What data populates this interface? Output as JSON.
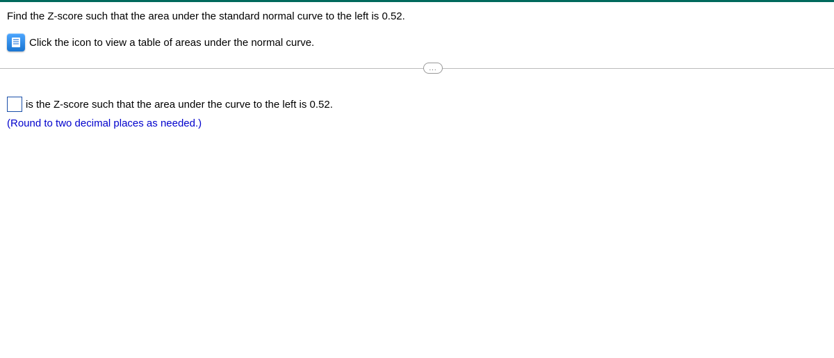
{
  "question": {
    "prompt": "Find the Z-score such that the area under the standard normal curve to the left is 0.52.",
    "icon_link_text": "Click the icon to view a table of areas under the normal curve."
  },
  "answer": {
    "input_value": "",
    "trailing_text": "is the Z-score such that the area under the curve to the left is 0.52.",
    "hint": "(Round to two decimal places as needed.)"
  },
  "divider": {
    "pill_label": "..."
  }
}
